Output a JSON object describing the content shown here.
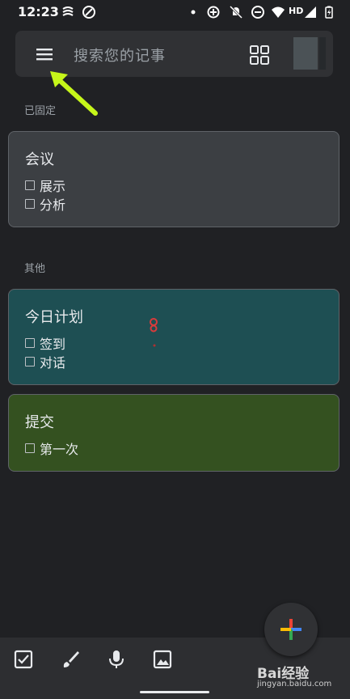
{
  "status_bar": {
    "time": "12:23",
    "hd_label": "HD"
  },
  "search_bar": {
    "placeholder": "搜索您的记事"
  },
  "pinned_section": {
    "label": "已固定",
    "notes": [
      {
        "title": "会议",
        "items": [
          "展示",
          "分析"
        ],
        "color": "#3c3f43"
      }
    ]
  },
  "other_section": {
    "label": "其他",
    "notes": [
      {
        "title": "今日计划",
        "items": [
          "签到",
          "对话"
        ],
        "color": "#1e4f53"
      },
      {
        "title": "提交",
        "items": [
          "第一次"
        ],
        "color": "#345120"
      }
    ]
  },
  "bottom_bar": {
    "icons": [
      "checkbox-icon",
      "brush-icon",
      "mic-icon",
      "image-icon"
    ]
  },
  "fab": {
    "icon": "plus-icon",
    "colors": [
      "#ea4335",
      "#fbbc04",
      "#34a853",
      "#4285f4"
    ]
  },
  "watermark": {
    "brand": "Bai经验",
    "url": "jingyan.baidu.com"
  },
  "colors": {
    "background": "#202124",
    "surface": "#303134",
    "accent_arrow": "#c6f61a"
  }
}
